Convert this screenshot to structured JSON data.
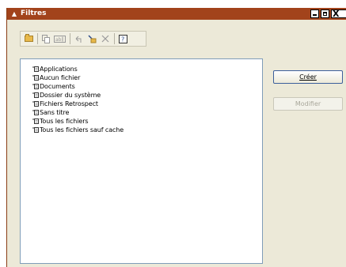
{
  "window": {
    "title": "Filtres",
    "minimize_glyph": "_",
    "maximize_glyph": "□",
    "close_glyph": "X"
  },
  "toolbar": {
    "buttons": [
      {
        "name": "new-folder",
        "icon": "folder-icon",
        "enabled": true
      },
      {
        "name": "copy",
        "icon": "copy-icon",
        "enabled": false
      },
      {
        "name": "rename",
        "icon": "rename-icon",
        "label": "ab|",
        "enabled": false
      },
      {
        "name": "undo",
        "icon": "undo-icon",
        "enabled": false
      },
      {
        "name": "new-filter",
        "icon": "new-filter-icon",
        "enabled": true
      },
      {
        "name": "delete",
        "icon": "delete-icon",
        "enabled": false
      },
      {
        "name": "help",
        "icon": "help-icon",
        "label": "?",
        "enabled": true
      }
    ]
  },
  "filters": [
    "Applications",
    "Aucun fichier",
    "Documents",
    "Dossier du système",
    "Fichiers Retrospect",
    "Sans titre",
    "Tous les fichiers",
    "Tous les fichiers sauf cache"
  ],
  "buttons": {
    "create": "Créer",
    "modify": "Modifier"
  },
  "colors": {
    "titlebar": "#a2431b",
    "window_bg": "#ece9d8",
    "list_border": "#7f9db9"
  }
}
